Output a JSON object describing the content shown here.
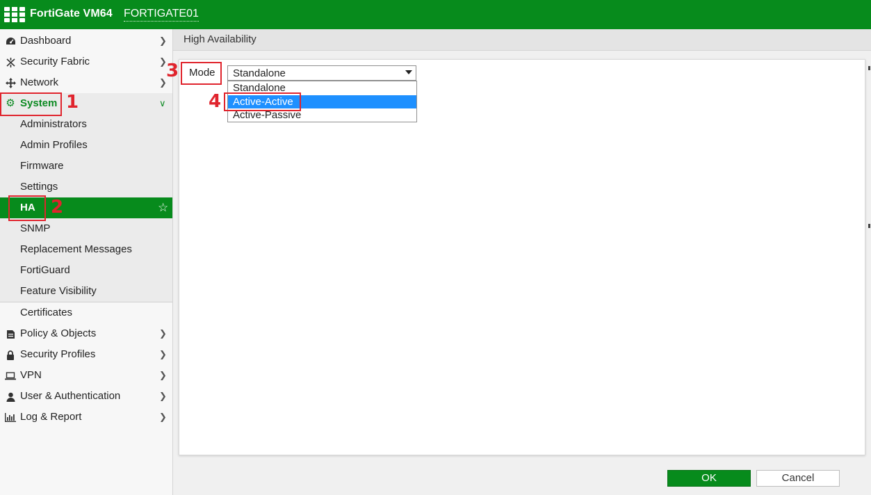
{
  "header": {
    "app_name": "FortiGate VM64",
    "hostname": "FORTIGATE01"
  },
  "sidebar": {
    "items": [
      {
        "label": "Dashboard",
        "icon": "dashboard-icon"
      },
      {
        "label": "Security Fabric",
        "icon": "security-fabric-icon"
      },
      {
        "label": "Network",
        "icon": "network-icon"
      },
      {
        "label": "System",
        "icon": "gear-icon"
      },
      {
        "label": "Administrators"
      },
      {
        "label": "Admin Profiles"
      },
      {
        "label": "Firmware"
      },
      {
        "label": "Settings"
      },
      {
        "label": "HA"
      },
      {
        "label": "SNMP"
      },
      {
        "label": "Replacement Messages"
      },
      {
        "label": "FortiGuard"
      },
      {
        "label": "Feature Visibility"
      },
      {
        "label": "Certificates"
      },
      {
        "label": "Policy & Objects",
        "icon": "policy-icon"
      },
      {
        "label": "Security Profiles",
        "icon": "lock-icon"
      },
      {
        "label": "VPN",
        "icon": "laptop-icon"
      },
      {
        "label": "User & Authentication",
        "icon": "user-icon"
      },
      {
        "label": "Log & Report",
        "icon": "bar-chart-icon"
      }
    ]
  },
  "main": {
    "title": "High Availability",
    "mode_label": "Mode",
    "mode_selected": "Standalone",
    "mode_options": [
      "Standalone",
      "Active-Active",
      "Active-Passive"
    ],
    "highlighted_option": "Active-Active"
  },
  "annotations": {
    "step1": "1",
    "step2": "2",
    "step3": "3",
    "step4": "4",
    "color": "#e0242d"
  },
  "footer": {
    "ok_label": "OK",
    "cancel_label": "Cancel"
  },
  "colors": {
    "brand_green": "#078b1c",
    "highlight_blue": "#1e90ff"
  }
}
